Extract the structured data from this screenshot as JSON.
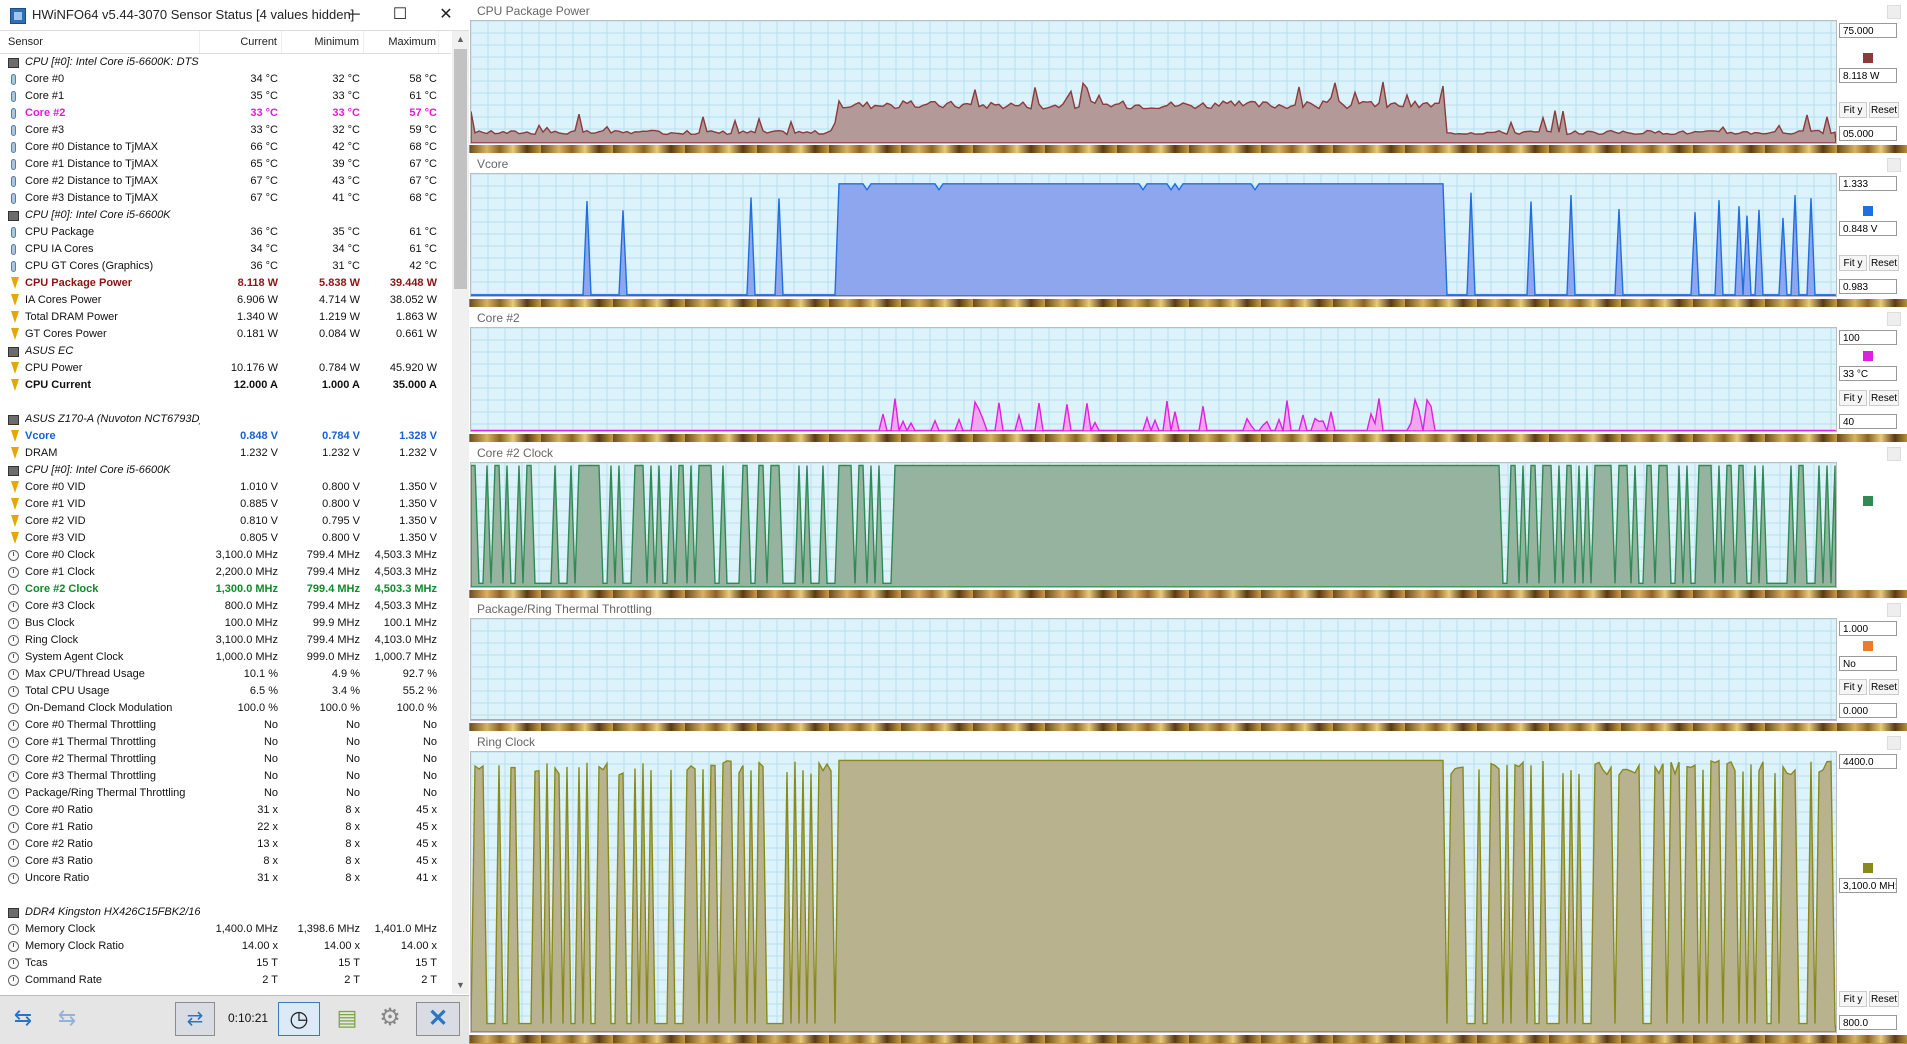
{
  "window": {
    "title": "HWiNFO64 v5.44-3070 Sensor Status [4 values hidden]",
    "minimize_glyph": "─",
    "maximize_glyph": "☐",
    "close_glyph": "✕"
  },
  "columns": {
    "sensor": "Sensor",
    "current": "Current",
    "minimum": "Minimum",
    "maximum": "Maximum"
  },
  "rows": [
    {
      "type": "group",
      "name": "CPU [#0]: Intel Core i5-6600K: DTS"
    },
    {
      "icon": "therm",
      "name": "Core #0",
      "cur": "34 °C",
      "min": "32 °C",
      "max": "58 °C"
    },
    {
      "icon": "therm",
      "name": "Core #1",
      "cur": "35 °C",
      "min": "33 °C",
      "max": "61 °C"
    },
    {
      "icon": "therm",
      "name": "Core #2",
      "cur": "33 °C",
      "min": "33 °C",
      "max": "57 °C",
      "hl": "mag"
    },
    {
      "icon": "therm",
      "name": "Core #3",
      "cur": "33 °C",
      "min": "32 °C",
      "max": "59 °C"
    },
    {
      "icon": "therm",
      "name": "Core #0 Distance to TjMAX",
      "cur": "66 °C",
      "min": "42 °C",
      "max": "68 °C"
    },
    {
      "icon": "therm",
      "name": "Core #1 Distance to TjMAX",
      "cur": "65 °C",
      "min": "39 °C",
      "max": "67 °C"
    },
    {
      "icon": "therm",
      "name": "Core #2 Distance to TjMAX",
      "cur": "67 °C",
      "min": "43 °C",
      "max": "67 °C"
    },
    {
      "icon": "therm",
      "name": "Core #3 Distance to TjMAX",
      "cur": "67 °C",
      "min": "41 °C",
      "max": "68 °C"
    },
    {
      "type": "group",
      "name": "CPU [#0]: Intel Core i5-6600K"
    },
    {
      "icon": "therm",
      "name": "CPU Package",
      "cur": "36 °C",
      "min": "35 °C",
      "max": "61 °C"
    },
    {
      "icon": "therm",
      "name": "CPU IA Cores",
      "cur": "34 °C",
      "min": "34 °C",
      "max": "61 °C"
    },
    {
      "icon": "therm",
      "name": "CPU GT Cores (Graphics)",
      "cur": "36 °C",
      "min": "31 °C",
      "max": "42 °C"
    },
    {
      "icon": "bolt",
      "name": "CPU Package Power",
      "cur": "8.118 W",
      "min": "5.838 W",
      "max": "39.448 W",
      "hl": "red"
    },
    {
      "icon": "bolt",
      "name": "IA Cores Power",
      "cur": "6.906 W",
      "min": "4.714 W",
      "max": "38.052 W"
    },
    {
      "icon": "bolt",
      "name": "Total DRAM Power",
      "cur": "1.340 W",
      "min": "1.219 W",
      "max": "1.863 W"
    },
    {
      "icon": "bolt",
      "name": "GT Cores Power",
      "cur": "0.181 W",
      "min": "0.084 W",
      "max": "0.661 W"
    },
    {
      "type": "group",
      "name": "ASUS EC"
    },
    {
      "icon": "bolt",
      "name": "CPU Power",
      "cur": "10.176 W",
      "min": "0.784 W",
      "max": "45.920 W"
    },
    {
      "icon": "bolt",
      "name": "CPU Current",
      "cur": "12.000 A",
      "min": "1.000 A",
      "max": "35.000 A",
      "hl": "black"
    },
    {
      "type": "spacer"
    },
    {
      "type": "group",
      "name": "ASUS Z170-A (Nuvoton NCT6793D)"
    },
    {
      "icon": "bolt",
      "name": "Vcore",
      "cur": "0.848 V",
      "min": "0.784 V",
      "max": "1.328 V",
      "hl": "blue"
    },
    {
      "icon": "bolt",
      "name": "DRAM",
      "cur": "1.232 V",
      "min": "1.232 V",
      "max": "1.232 V"
    },
    {
      "type": "group",
      "name": "CPU [#0]: Intel Core i5-6600K"
    },
    {
      "icon": "bolt",
      "name": "Core #0 VID",
      "cur": "1.010 V",
      "min": "0.800 V",
      "max": "1.350 V"
    },
    {
      "icon": "bolt",
      "name": "Core #1 VID",
      "cur": "0.885 V",
      "min": "0.800 V",
      "max": "1.350 V"
    },
    {
      "icon": "bolt",
      "name": "Core #2 VID",
      "cur": "0.810 V",
      "min": "0.795 V",
      "max": "1.350 V"
    },
    {
      "icon": "bolt",
      "name": "Core #3 VID",
      "cur": "0.805 V",
      "min": "0.800 V",
      "max": "1.350 V"
    },
    {
      "icon": "clock",
      "name": "Core #0 Clock",
      "cur": "3,100.0 MHz",
      "min": "799.4 MHz",
      "max": "4,503.3 MHz"
    },
    {
      "icon": "clock",
      "name": "Core #1 Clock",
      "cur": "2,200.0 MHz",
      "min": "799.4 MHz",
      "max": "4,503.3 MHz"
    },
    {
      "icon": "clock",
      "name": "Core #2 Clock",
      "cur": "1,300.0 MHz",
      "min": "799.4 MHz",
      "max": "4,503.3 MHz",
      "hl": "green"
    },
    {
      "icon": "clock",
      "name": "Core #3 Clock",
      "cur": "800.0 MHz",
      "min": "799.4 MHz",
      "max": "4,503.3 MHz"
    },
    {
      "icon": "clock",
      "name": "Bus Clock",
      "cur": "100.0 MHz",
      "min": "99.9 MHz",
      "max": "100.1 MHz"
    },
    {
      "icon": "clock",
      "name": "Ring Clock",
      "cur": "3,100.0 MHz",
      "min": "799.4 MHz",
      "max": "4,103.0 MHz"
    },
    {
      "icon": "clock",
      "name": "System Agent Clock",
      "cur": "1,000.0 MHz",
      "min": "999.0 MHz",
      "max": "1,000.7 MHz"
    },
    {
      "icon": "clock",
      "name": "Max CPU/Thread Usage",
      "cur": "10.1 %",
      "min": "4.9 %",
      "max": "92.7 %"
    },
    {
      "icon": "clock",
      "name": "Total CPU Usage",
      "cur": "6.5 %",
      "min": "3.4 %",
      "max": "55.2 %"
    },
    {
      "icon": "clock",
      "name": "On-Demand Clock Modulation",
      "cur": "100.0 %",
      "min": "100.0 %",
      "max": "100.0 %"
    },
    {
      "icon": "clock",
      "name": "Core #0 Thermal Throttling",
      "cur": "No",
      "min": "No",
      "max": "No"
    },
    {
      "icon": "clock",
      "name": "Core #1 Thermal Throttling",
      "cur": "No",
      "min": "No",
      "max": "No"
    },
    {
      "icon": "clock",
      "name": "Core #2 Thermal Throttling",
      "cur": "No",
      "min": "No",
      "max": "No"
    },
    {
      "icon": "clock",
      "name": "Core #3 Thermal Throttling",
      "cur": "No",
      "min": "No",
      "max": "No"
    },
    {
      "icon": "clock",
      "name": "Package/Ring Thermal Throttling",
      "cur": "No",
      "min": "No",
      "max": "No"
    },
    {
      "icon": "clock",
      "name": "Core #0 Ratio",
      "cur": "31 x",
      "min": "8 x",
      "max": "45 x"
    },
    {
      "icon": "clock",
      "name": "Core #1 Ratio",
      "cur": "22 x",
      "min": "8 x",
      "max": "45 x"
    },
    {
      "icon": "clock",
      "name": "Core #2 Ratio",
      "cur": "13 x",
      "min": "8 x",
      "max": "45 x"
    },
    {
      "icon": "clock",
      "name": "Core #3 Ratio",
      "cur": "8 x",
      "min": "8 x",
      "max": "45 x"
    },
    {
      "icon": "clock",
      "name": "Uncore Ratio",
      "cur": "31 x",
      "min": "8 x",
      "max": "41 x"
    },
    {
      "type": "spacer"
    },
    {
      "type": "group",
      "name": "DDR4 Kingston HX426C15FBK2/16"
    },
    {
      "icon": "clock",
      "name": "Memory Clock",
      "cur": "1,400.0 MHz",
      "min": "1,398.6 MHz",
      "max": "1,401.0 MHz"
    },
    {
      "icon": "clock",
      "name": "Memory Clock Ratio",
      "cur": "14.00 x",
      "min": "14.00 x",
      "max": "14.00 x"
    },
    {
      "icon": "clock",
      "name": "Tcas",
      "cur": "15 T",
      "min": "15 T",
      "max": "15 T"
    },
    {
      "icon": "clock",
      "name": "Command Rate",
      "cur": "2 T",
      "min": "2 T",
      "max": "2 T"
    }
  ],
  "toolbar": {
    "timer": "0:10:21",
    "nav_glyph": "⇆",
    "nav2_glyph": "⇆",
    "net_glyph": "⇄",
    "clock_glyph": "◷",
    "report_glyph": "▤",
    "settings_glyph": "⚙",
    "close_glyph": "✕"
  },
  "graphs": [
    {
      "title": "CPU Package Power",
      "color": "#8c3a3a",
      "fill": "#b39a99",
      "max_label": "75.000",
      "current_label": "8.118 W",
      "min_label": "05.000",
      "fit_label": "Fit y",
      "reset_label": "Reset",
      "kind": "power"
    },
    {
      "title": "Vcore",
      "color": "#1f6fe0",
      "fill": "#8ea6ee",
      "max_label": "1.333",
      "current_label": "0.848 V",
      "min_label": "0.983",
      "fit_label": "Fit y",
      "reset_label": "Reset",
      "kind": "vcore"
    },
    {
      "title": "Core #2",
      "color": "#e020e0",
      "fill": "#f3a6f0",
      "max_label": "100",
      "current_label": "33 °C",
      "min_label": "40",
      "fit_label": "Fit y",
      "reset_label": "Reset",
      "kind": "temp"
    },
    {
      "title": "Core #2 Clock",
      "color": "#2f8a54",
      "fill": "#95b39f",
      "max_label": "",
      "current_label": "",
      "min_label": "",
      "fit_label": "",
      "reset_label": "",
      "kind": "clock"
    },
    {
      "title": "Package/Ring Thermal Throttling",
      "color": "#f07a26",
      "fill": "#f0b58a",
      "max_label": "1.000",
      "current_label": "No",
      "min_label": "0.000",
      "fit_label": "Fit y",
      "reset_label": "Reset",
      "kind": "flat"
    },
    {
      "title": "Ring Clock",
      "color": "#8a8a1a",
      "fill": "#b8b28e",
      "max_label": "4400.0",
      "current_label": "3,100.0 MH:",
      "min_label": "800.0",
      "fit_label": "Fit y",
      "reset_label": "Reset",
      "kind": "ring"
    }
  ]
}
